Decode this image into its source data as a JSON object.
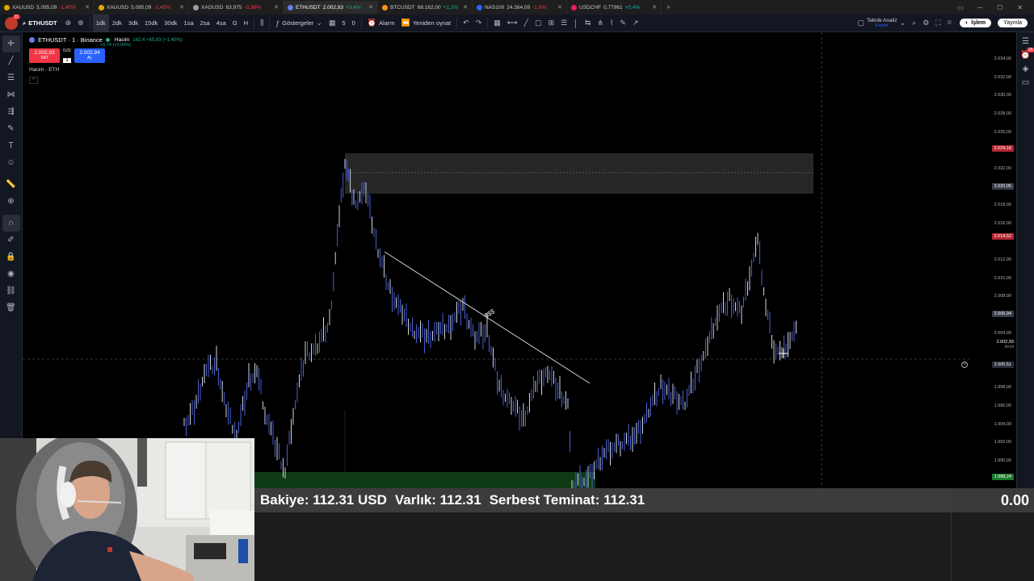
{
  "browser_tabs": [
    {
      "symbol": "XAUUSD",
      "price": "5.095,09",
      "change": "-1,45%",
      "dir": "down",
      "color": "#e0a800"
    },
    {
      "symbol": "XAUUSD",
      "price": "5.095,09",
      "change": "-1,45%",
      "dir": "down",
      "color": "#e0a800"
    },
    {
      "symbol": "XAGUSD",
      "price": "83,975",
      "change": "-0,38%",
      "dir": "down",
      "color": "#9aa0a6"
    },
    {
      "symbol": "ETHUSDT",
      "price": "2.002,93",
      "change": "+3,4%",
      "dir": "up",
      "color": "#627eea"
    },
    {
      "symbol": "BTCUSDT",
      "price": "68.162,00",
      "change": "+1,2%",
      "dir": "up",
      "color": "#f7931a"
    },
    {
      "symbol": "NAS100",
      "price": "24.364,09",
      "change": "-1,6%",
      "dir": "down",
      "color": "#2962ff"
    },
    {
      "symbol": "USDCHF",
      "price": "0,77961",
      "change": "+0,4%",
      "dir": "up",
      "color": "#e91e63"
    }
  ],
  "toolbar": {
    "avatar_badge": "11",
    "symbol": "ETHUSDT",
    "intervals": [
      "1dk",
      "2dk",
      "3dk",
      "15dk",
      "30dk",
      "1sa",
      "2sa",
      "4sa",
      "G",
      "H"
    ],
    "active_interval": "1dk",
    "indicators_label": "Göstergeler",
    "layout_count": "5",
    "alert_count": "0",
    "alarm_label": "Alarm",
    "replay_label": "Yeniden oynat",
    "analysis_label": "Teknik Analiz",
    "analysis_sub": "Kaydet",
    "trade_label": "İşlem",
    "publish_label": "Yayınla"
  },
  "legend": {
    "title": "ETHUSDT · 1 · Binance",
    "change": "+0,74 (+0,04%)",
    "volume_label": "Hacim",
    "volume_value": "142,4  +65,83 (+1,40%)"
  },
  "trade_buttons": {
    "sell_price": "2.002,93",
    "sell_label": "SAT",
    "spread": "0,01",
    "quantity": "1",
    "buy_price": "2.002,94",
    "buy_label": "AL"
  },
  "volume_pane_label": "Hacim - ETH",
  "drawing_label": "$$$",
  "price_axis": {
    "ticks": [
      "2.034,00",
      "2.032,00",
      "2.030,00",
      "2.028,00",
      "2.026,00",
      "2.022,00",
      "2.018,00",
      "2.016,00",
      "2.012,00",
      "2.010,00",
      "2.008,00",
      "2.004,00",
      "1.998,00",
      "1.996,00",
      "1.994,00",
      "1.992,00",
      "1.990,00"
    ],
    "tags": [
      {
        "price": "2.024,16",
        "style": "red"
      },
      {
        "price": "2.020,05",
        "style": "grey"
      },
      {
        "price": "2.014,52",
        "style": "red"
      },
      {
        "price": "2.006,04",
        "style": "grey"
      },
      {
        "price": "2.000,51",
        "style": "dark"
      },
      {
        "price": "1.988,24",
        "style": "green"
      }
    ],
    "current_price": "2.002,93",
    "countdown": "00:03"
  },
  "bottom_panel": {
    "balance": "Bakiye: 112.31 USD",
    "equity": "Varlık: 112.31",
    "free_margin": "Serbest Teminat: 112.31",
    "pnl": "0.00"
  },
  "right_bar_badge": "26",
  "colors": {
    "up": "#22ab94",
    "down": "#f23645",
    "accent": "#2962ff",
    "candles": "#4a5fd0"
  }
}
